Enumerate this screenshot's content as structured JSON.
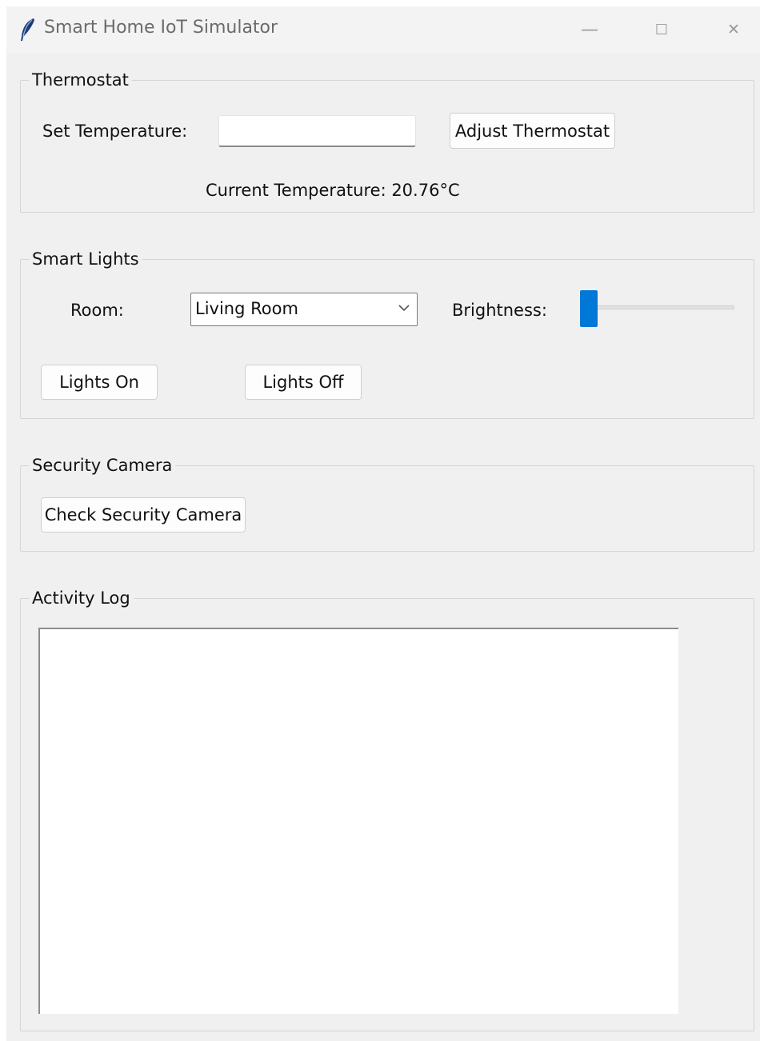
{
  "window": {
    "title": "Smart Home IoT Simulator",
    "controls": {
      "minimize": "—",
      "maximize": "☐",
      "close": "✕"
    }
  },
  "thermostat": {
    "group_label": "Thermostat",
    "set_label": "Set Temperature:",
    "input_value": "",
    "adjust_button": "Adjust Thermostat",
    "current_text": "Current Temperature: 20.76°C"
  },
  "lights": {
    "group_label": "Smart Lights",
    "room_label": "Room:",
    "room_selected": "Living Room",
    "brightness_label": "Brightness:",
    "brightness_level": 0,
    "on_button": "Lights On",
    "off_button": "Lights Off"
  },
  "security": {
    "group_label": "Security Camera",
    "check_button": "Check Security Camera"
  },
  "log": {
    "group_label": "Activity Log",
    "content": ""
  },
  "colors": {
    "accent": "#0078d7",
    "window_bg": "#f0f0f0",
    "title_text": "#6b6b6b"
  }
}
